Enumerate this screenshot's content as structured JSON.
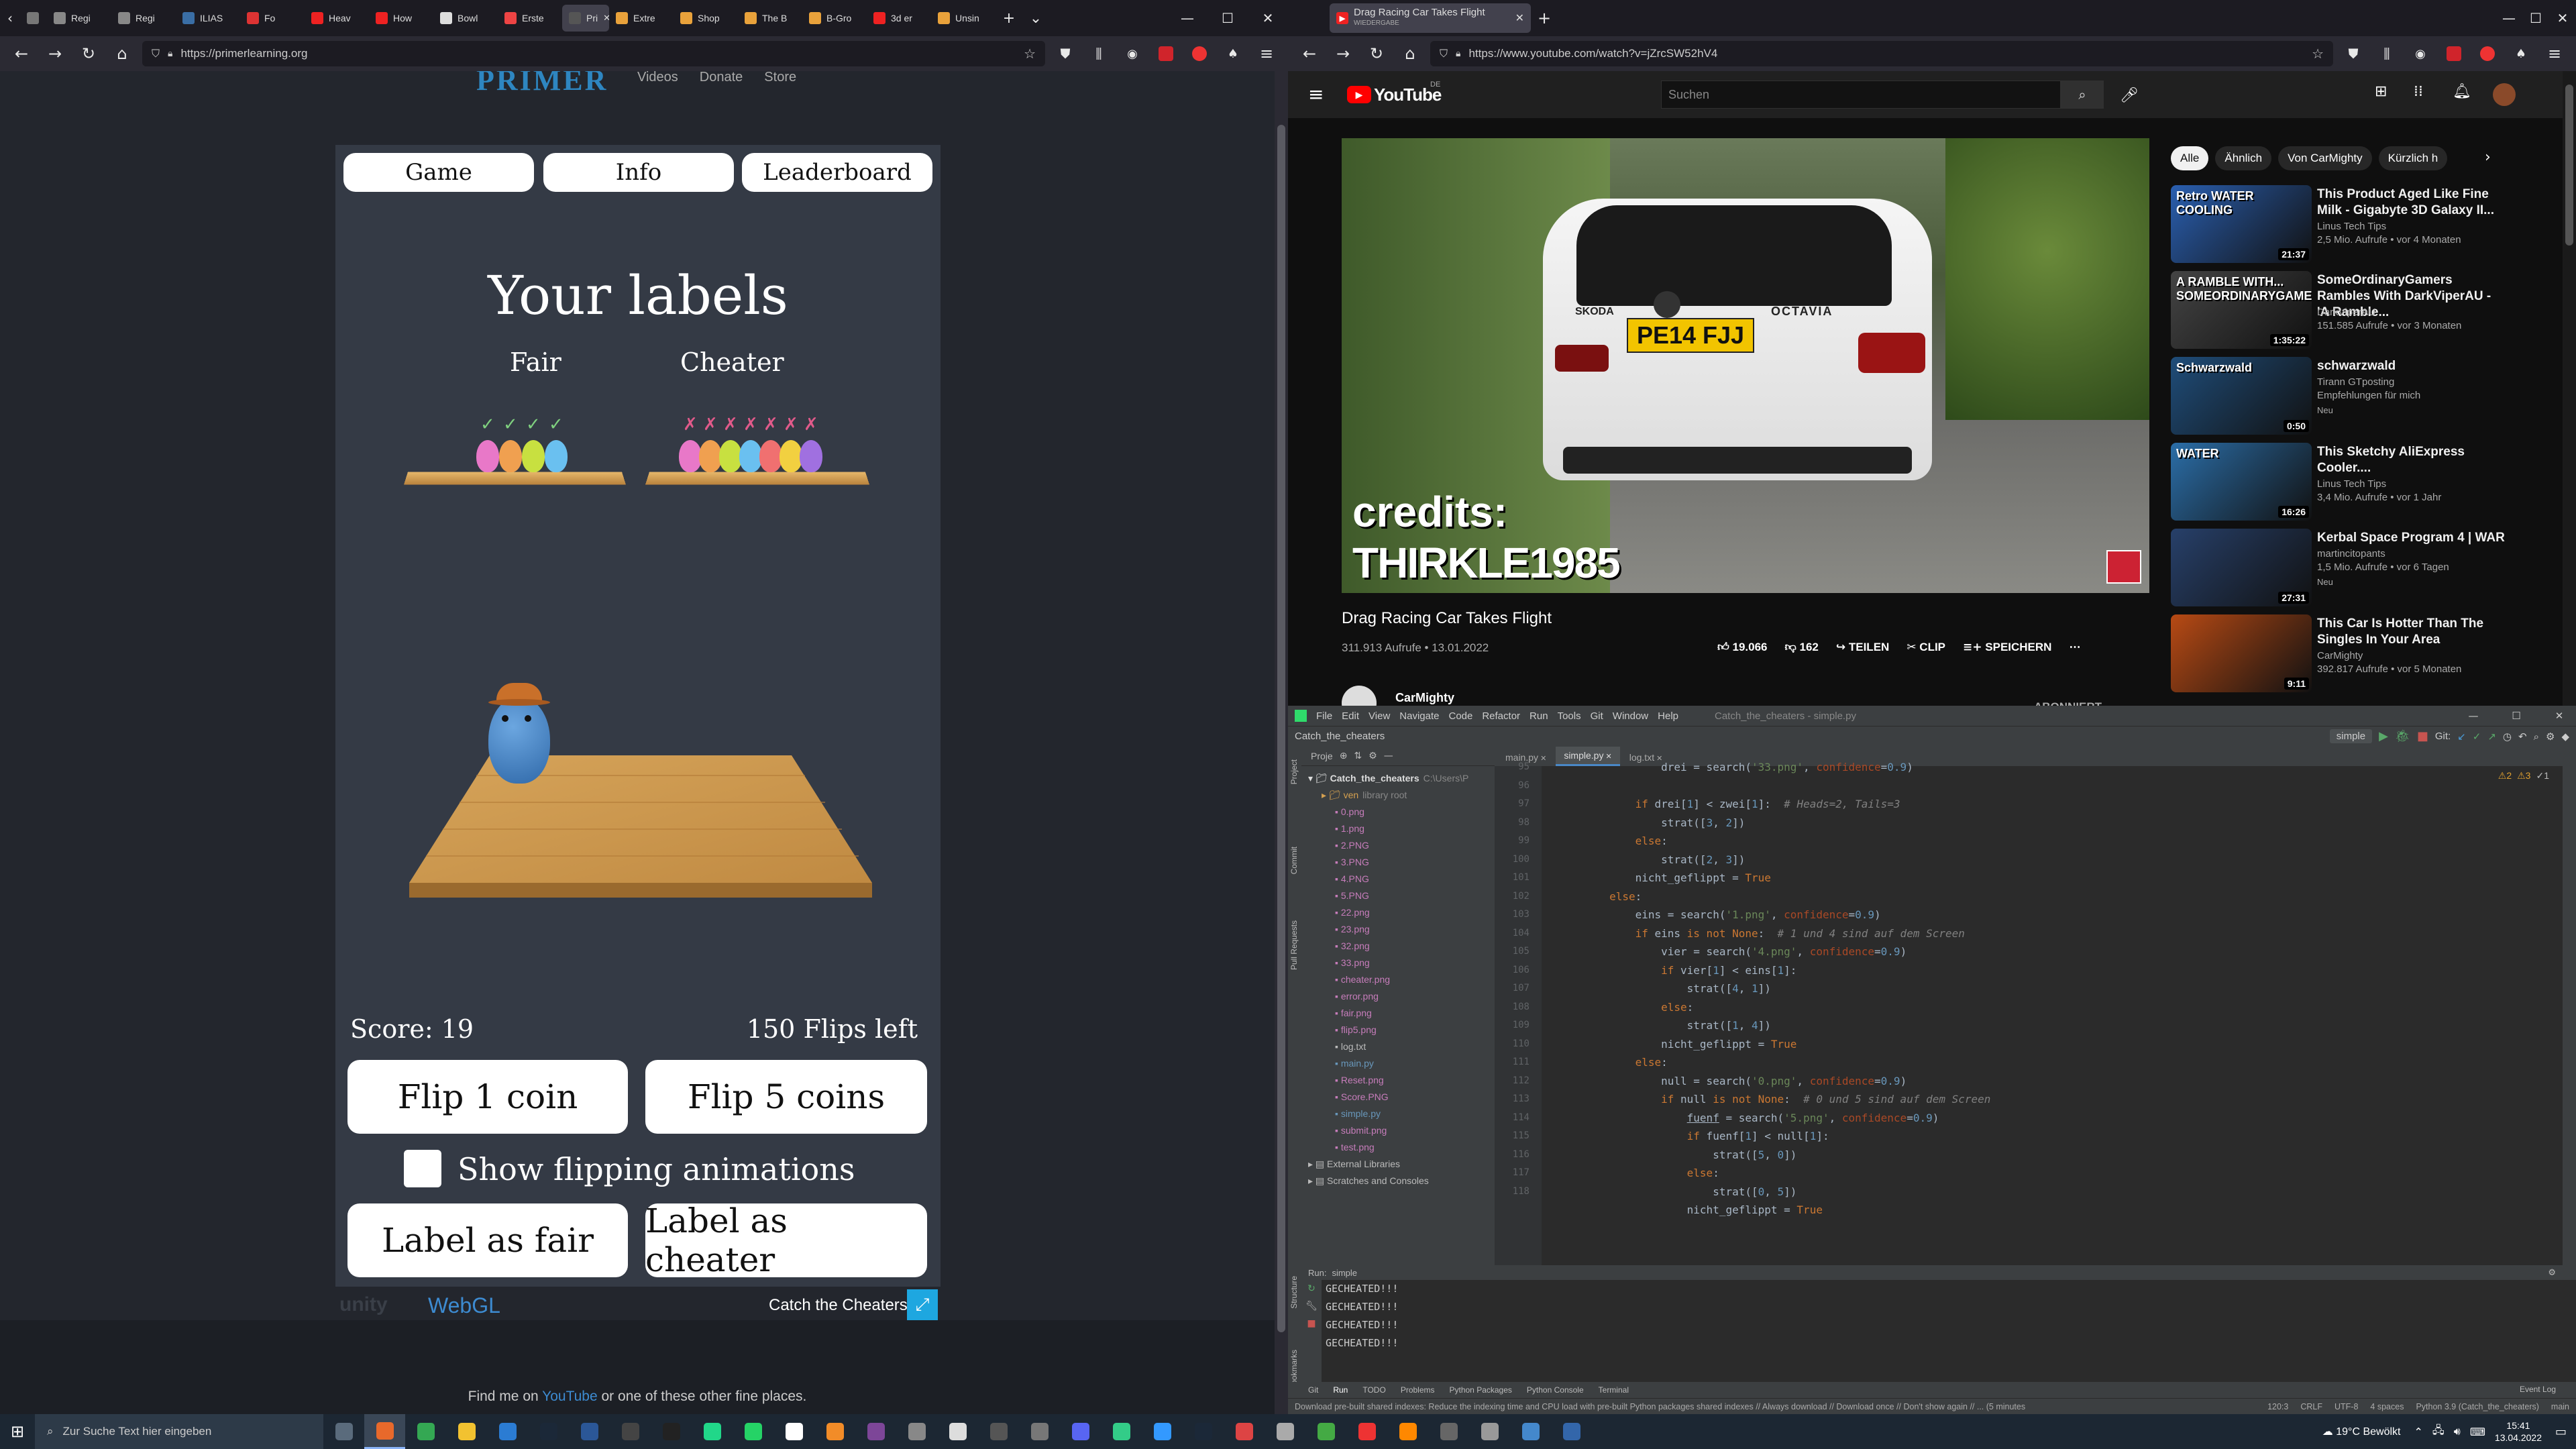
{
  "left_browser": {
    "tabs": [
      "Regi",
      "Regi",
      "ILIAS",
      "Fo",
      "Heav",
      "How",
      "Bowl",
      "Erste",
      "Pri",
      "Extre",
      "Shop",
      "The B",
      "B-Gro",
      "3d er",
      "Unsin"
    ],
    "active_tab_index": 8,
    "url": "https://primerlearning.org",
    "site_nav": [
      "Videos",
      "Donate",
      "Store"
    ],
    "site_logo": "PRIMER"
  },
  "game": {
    "tabs": {
      "game": "Game",
      "info": "Info",
      "leaderboard": "Leaderboard"
    },
    "heading": "Your labels",
    "fair_label": "Fair",
    "cheater_label": "Cheater",
    "score_text": "Score: 19",
    "flips_left_text": "150 Flips left",
    "flip1_label": "Flip 1 coin",
    "flip5_label": "Flip 5 coins",
    "animations_label": "Show flipping animations",
    "label_fair_button": "Label as fair",
    "label_cheater_button": "Label as cheater",
    "webgl_label": "WebGL",
    "unity_label": "unity",
    "app_name": "Catch the Cheaters",
    "fair_count": 4,
    "cheater_count": 7
  },
  "footer": {
    "text_before": "Find me on ",
    "youtube_link": "YouTube",
    "text_after": " or one of these other fine places.",
    "social_icons": [
      "youtube-icon",
      "patreon-icon",
      "discord-icon",
      "twitter-icon",
      "reddit-icon",
      "github-icon",
      "email-icon"
    ]
  },
  "youtube": {
    "tab_title": "Drag Racing Car Takes Flight",
    "tab_sub": "WIEDERGABE",
    "url": "https://www.youtube.com/watch?v=jZrcSW52hV4",
    "logo_text": "YouTube",
    "logo_region": "DE",
    "search_placeholder": "Suchen",
    "video_overlay_line1": "credits:",
    "video_overlay_line2": "THIRKLE1985",
    "plate_text": "PE14 FJJ",
    "car_brand": "SKODA",
    "car_model": "OCTAVIA",
    "video_title": "Drag Racing Car Takes Flight",
    "views_date": "311.913 Aufrufe • 13.01.2022",
    "likes": "19.066",
    "dislikes": "162",
    "share": "TEILEN",
    "clip": "CLIP",
    "save": "SPEICHERN",
    "channel": "CarMighty",
    "subscribe": "ABONNIERT",
    "chips": [
      "Alle",
      "Ähnlich",
      "Von CarMighty",
      "Kürzlich h"
    ],
    "sidebar": [
      {
        "title": "This Product Aged Like Fine Milk - Gigabyte 3D Galaxy II...",
        "channel": "Linus Tech Tips",
        "meta": "2,5 Mio. Aufrufe • vor 4 Monaten",
        "duration": "21:37",
        "thumb_text": "Retro WATER COOLING",
        "color": "#2a5fb0"
      },
      {
        "title": "SomeOrdinaryGamers Rambles With DarkViperAU - 'A Ramble...",
        "channel": "DarkViperAU",
        "meta": "151.585 Aufrufe • vor 3 Monaten",
        "duration": "1:35:22",
        "thumb_text": "A RAMBLE WITH... SOMEORDINARYGAMERS",
        "color": "#444"
      },
      {
        "title": "schwarzwald",
        "channel": "Tirann GTposting",
        "meta": "Empfehlungen für mich",
        "extra": "Neu",
        "duration": "0:50",
        "thumb_text": "Schwarzwald",
        "color": "#1f4d7a"
      },
      {
        "title": "This Sketchy AliExpress Cooler....",
        "channel": "Linus Tech Tips",
        "meta": "3,4 Mio. Aufrufe • vor 1 Jahr",
        "duration": "16:26",
        "thumb_text": "WATER",
        "color": "#2b6ea8"
      },
      {
        "title": "Kerbal Space Program 4 | WAR",
        "channel": "martincitopants",
        "meta": "1,5 Mio. Aufrufe • vor 6 Tagen",
        "extra": "Neu",
        "duration": "27:31",
        "thumb_text": "",
        "color": "#27406a"
      },
      {
        "title": "This Car Is Hotter Than The Singles In Your Area",
        "channel": "CarMighty",
        "meta": "392.817 Aufrufe • vor 5 Monaten",
        "duration": "9:11",
        "thumb_text": "",
        "color": "#b84a14"
      }
    ]
  },
  "ide": {
    "window_title": "Catch_the_cheaters - simple.py",
    "menu": [
      "File",
      "Edit",
      "View",
      "Navigate",
      "Code",
      "Refactor",
      "Run",
      "Tools",
      "Git",
      "Window",
      "Help"
    ],
    "project_name": "Catch_the_cheaters",
    "run_config": "simple",
    "git_label": "Git:",
    "project_tab": "Proje",
    "editor_tabs": [
      "main.py",
      "simple.py",
      "log.txt"
    ],
    "tree_root": "Catch_the_cheaters",
    "tree_root_path": "C:\\Users\\P",
    "venv": "ven",
    "venv_note": "library root",
    "files": [
      "0.png",
      "1.png",
      "2.PNG",
      "3.PNG",
      "4.PNG",
      "5.PNG",
      "22.png",
      "23.png",
      "32.png",
      "33.png",
      "cheater.png",
      "error.png",
      "fair.png",
      "flip5.png",
      "log.txt",
      "main.py",
      "Reset.png",
      "Score.PNG",
      "simple.py",
      "submit.png",
      "test.png"
    ],
    "external_libraries": "External Libraries",
    "scratches": "Scratches and Consoles",
    "line_numbers": [
      "95",
      "96",
      "97",
      "98",
      "99",
      "100",
      "101",
      "102",
      "103",
      "104",
      "105",
      "106",
      "107",
      "108",
      "109",
      "110",
      "111",
      "112",
      "113",
      "114",
      "115",
      "116",
      "117",
      "118"
    ],
    "inspection_counts": [
      "2",
      "3",
      "1"
    ],
    "run_tab": "Run:",
    "run_name": "simple",
    "console_lines": [
      "GECHEATED!!!",
      "GECHEATED!!!",
      "GECHEATED!!!",
      "GECHEATED!!!"
    ],
    "bottom_tabs": [
      "Git",
      "Run",
      "TODO",
      "Problems",
      "Python Packages",
      "Python Console",
      "Terminal"
    ],
    "event_log": "Event Log",
    "side_tabs": [
      "Project",
      "Commit",
      "Pull Requests",
      "Structure",
      "Bookmarks"
    ],
    "status_message": "Download pre-built shared indexes: Reduce the indexing time and CPU load with pre-built Python packages shared indexes // Always download // Download once // Don't show again // ... (5 minutes",
    "status_pos": "120:3",
    "status_crlf": "CRLF",
    "status_enc": "UTF-8",
    "status_indent": "4 spaces",
    "status_interp": "Python 3.9 (Catch_the_cheaters)",
    "status_branch": "main"
  },
  "taskbar": {
    "search_placeholder": "Zur Suche Text hier eingeben",
    "weather": "19°C  Bewölkt",
    "time": "15:41",
    "date": "13.04.2022"
  }
}
